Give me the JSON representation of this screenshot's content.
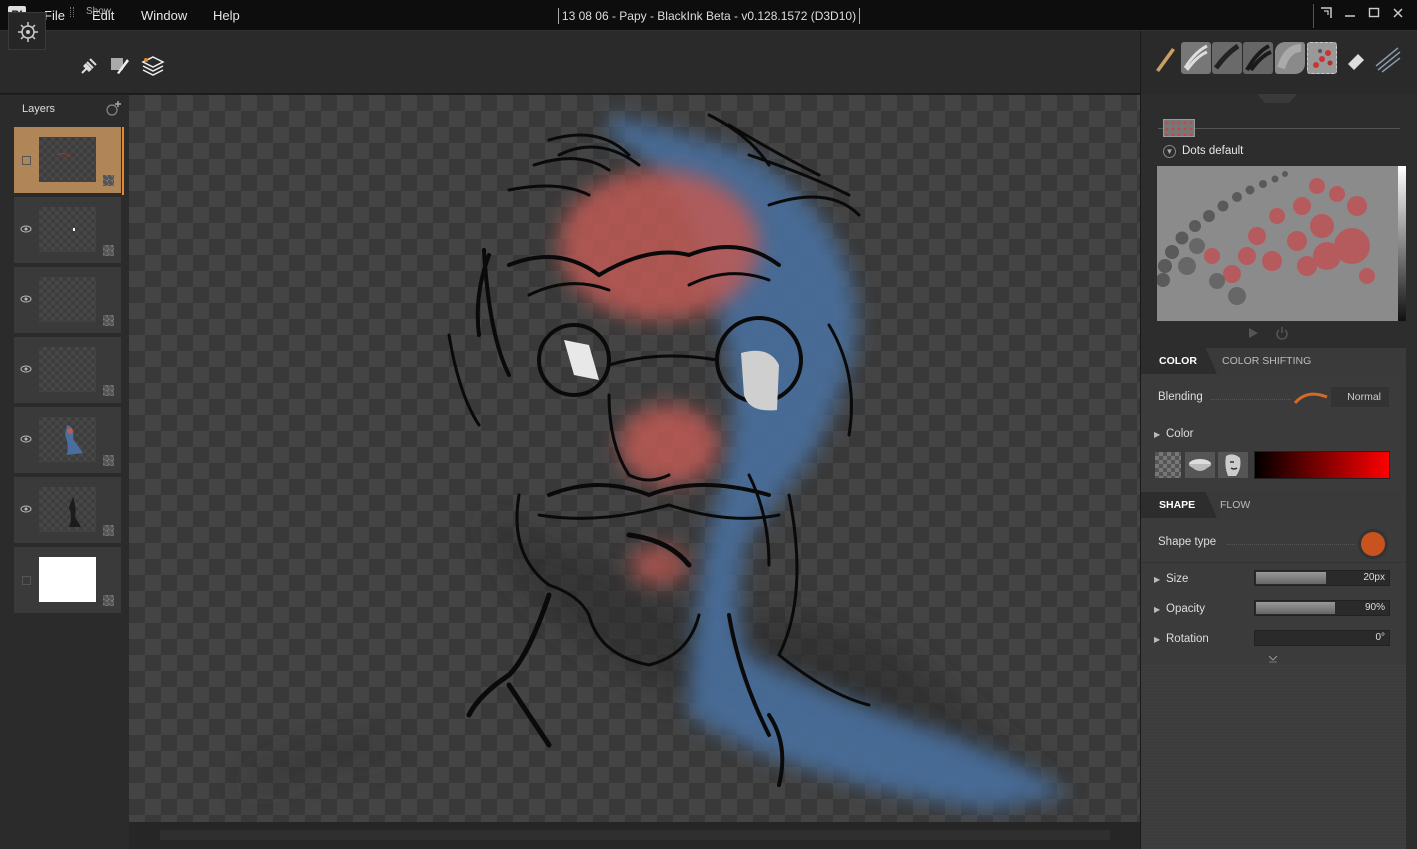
{
  "app": {
    "logo": "BI",
    "title": "13 08 06 - Papy - BlackInk Beta - v0.128.1572 (D3D10)",
    "menu": [
      "File",
      "Edit",
      "Window",
      "Help"
    ]
  },
  "toolbar": {
    "show_label": "Show",
    "icons": [
      "settings-wheel-icon",
      "plug-icon",
      "brush-layers-icon",
      "layers-stack-icon"
    ]
  },
  "layers": {
    "title": "Layers",
    "items": [
      {
        "visible": false,
        "selected": true,
        "content": "red-marks"
      },
      {
        "visible": true,
        "selected": false,
        "content": "white-dot"
      },
      {
        "visible": true,
        "selected": false,
        "content": "empty"
      },
      {
        "visible": true,
        "selected": false,
        "content": "empty"
      },
      {
        "visible": true,
        "selected": false,
        "content": "blue-figure"
      },
      {
        "visible": true,
        "selected": false,
        "content": "dark-figure"
      },
      {
        "visible": false,
        "selected": false,
        "content": "white-fill"
      }
    ]
  },
  "brush": {
    "preset_name": "Dots default",
    "presets": [
      "pen-brush",
      "chalk-brush",
      "ink-brush",
      "dark-brush",
      "sponge-brush",
      "dots-brush",
      "eraser-brush",
      "hatch-brush"
    ]
  },
  "color_panel": {
    "tabs": [
      "COLOR",
      "COLOR SHIFTING"
    ],
    "blending_label": "Blending",
    "blending_value": "Normal",
    "color_label": "Color",
    "gradient": [
      "#000000",
      "#ff0000"
    ]
  },
  "shape_panel": {
    "tabs": [
      "SHAPE",
      "FLOW"
    ],
    "shape_type_label": "Shape type",
    "shape_color": "#c8531f",
    "params": [
      {
        "label": "Size",
        "value": "20px",
        "fill": 0.53
      },
      {
        "label": "Opacity",
        "value": "90%",
        "fill": 0.59
      },
      {
        "label": "Rotation",
        "value": "0°",
        "fill": 0
      }
    ]
  },
  "colors": {
    "accent_orange": "#e08a2a",
    "selected_layer": "#b08558",
    "sketch_blue": "#4a6f9e",
    "sketch_red": "#c05a55"
  }
}
